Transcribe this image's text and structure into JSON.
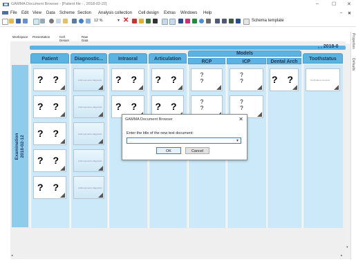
{
  "window": {
    "title": "GAMMA Document Browser - [Patient file - , 2018-02-22]",
    "minimize": "–",
    "maximize": "☐",
    "close": "✕",
    "mdi_close": "✕"
  },
  "menu": [
    "File",
    "Edit",
    "View",
    "Data",
    "Scheme",
    "Section",
    "Analysis collection",
    "Cell design",
    "Extras",
    "Windows",
    "Help"
  ],
  "toolbar": {
    "zoom": "12 %",
    "scheme_label": "Schema template"
  },
  "tabs": [
    "Workspace",
    "Presentation",
    "Cell Design",
    "Raw Data"
  ],
  "right_pane": [
    "Properties",
    "Defaults"
  ],
  "header_band": {
    "date_label": ", , 2018-0"
  },
  "row_label": {
    "line1": "Examination",
    "line2": "2018-02-12"
  },
  "columns": [
    "Patient",
    "Diagnostic...",
    "Intraoral",
    "Articulation",
    "RCP",
    "ICP",
    "Dental Arch",
    "Toothstatus"
  ],
  "models_group": "Models",
  "placeholder": "? ?",
  "thumb_text": "Anthropometric diagnostic",
  "tooth_thumb_text": "Toothstatus overview",
  "dialog": {
    "title": "GAMMA Document Browser",
    "close": "✕",
    "prompt": "Enter the title of the new text document:",
    "value": "",
    "ok": "OK",
    "cancel": "Cancel"
  },
  "colors": {
    "column_header": "#5bb3e2",
    "column_bg": "#cbe9f9",
    "row_header": "#8fcbea",
    "accent": "#2f7dd1"
  }
}
